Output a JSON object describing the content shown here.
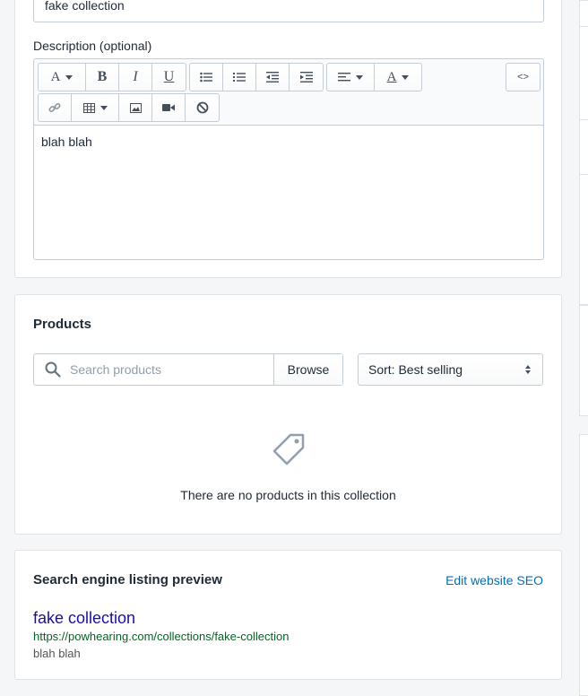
{
  "collection": {
    "title_value": "fake collection",
    "description_label": "Description (optional)",
    "description_text": "blah blah"
  },
  "editor_toolbar": {
    "font_button": "A",
    "bold_button": "B",
    "italic_button": "I",
    "underline_button": "U",
    "text_color_button": "A",
    "html_button": "<>"
  },
  "products": {
    "heading": "Products",
    "search_placeholder": "Search products",
    "browse_label": "Browse",
    "sort_label": "Sort: Best selling",
    "empty_message": "There are no products in this collection"
  },
  "seo": {
    "heading": "Search engine listing preview",
    "edit_link": "Edit website SEO",
    "preview_title": "fake collection",
    "preview_url": "https://powhearing.com/collections/fake-collection",
    "preview_description": "blah blah"
  },
  "colors": {
    "link_blue": "#006fbb",
    "seo_title": "#1a0dab",
    "seo_url": "#006621"
  }
}
